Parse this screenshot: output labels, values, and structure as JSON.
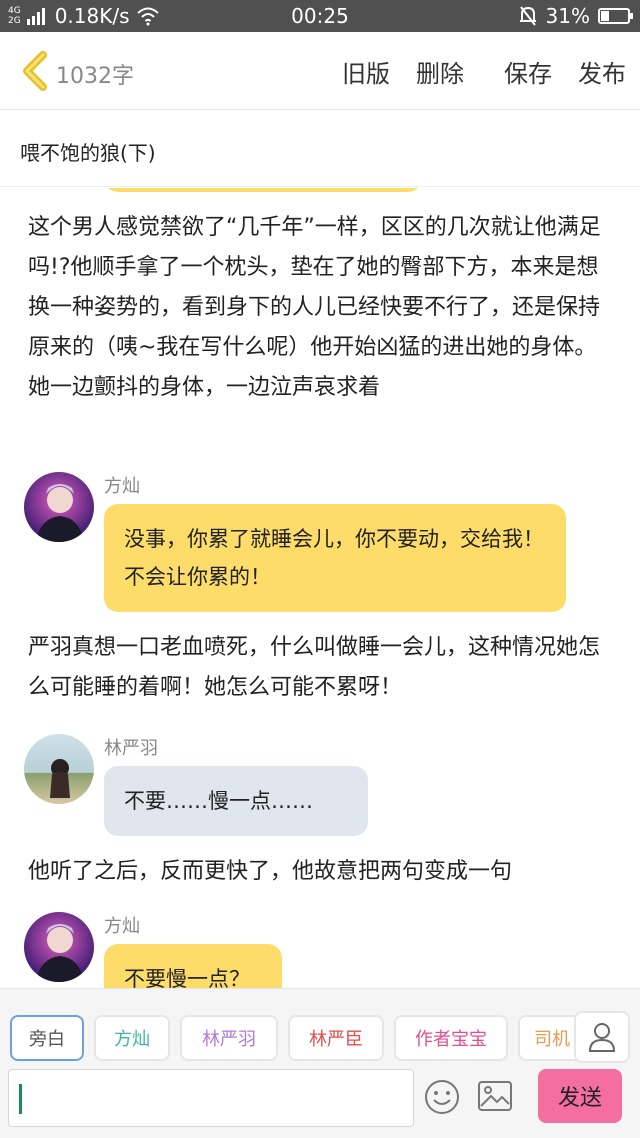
{
  "status_bar": {
    "network_top": "4G",
    "network_bottom": "2G",
    "speed": "0.18K/s",
    "time": "00:25",
    "battery": "31%",
    "battery_level": 0.31
  },
  "header": {
    "word_count": "1032字",
    "actions": [
      "旧版",
      "删除",
      "保存",
      "发布"
    ]
  },
  "story": {
    "title": "喂不饱的狼(下)"
  },
  "content": {
    "narration_1": "这个男人感觉禁欲了“几千年”一样，区区的几次就让他满足吗!?他顺手拿了一个枕头，垫在了她的臀部下方，本来是想换一种姿势的，看到身下的人儿已经快要不行了，还是保持原来的（咦~我在写什么呢）他开始凶猛的进出她的身体。她一边颤抖的身体，一边泣声哀求着",
    "msg_1": {
      "name": "方灿",
      "text": "没事，你累了就睡会儿，你不要动，交给我！不会让你累的！"
    },
    "narration_2": "严羽真想一口老血喷死，什么叫做睡一会儿，这种情况她怎么可能睡的着啊！她怎么可能不累呀！",
    "msg_2": {
      "name": "林严羽",
      "text": "不要……慢一点……"
    },
    "narration_3": "他听了之后，反而更快了，他故意把两句变成一句",
    "msg_3": {
      "name": "方灿",
      "text": "不要慢一点？"
    }
  },
  "roles": [
    "旁白",
    "方灿",
    "林严羽",
    "林严臣",
    "作者宝宝",
    "司机"
  ],
  "role_colors": [
    "#555555",
    "#3cb4a8",
    "#b07ad8",
    "#e0504a",
    "#e05090",
    "#e89a50"
  ],
  "composer": {
    "input_value": "",
    "send_label": "发送"
  }
}
